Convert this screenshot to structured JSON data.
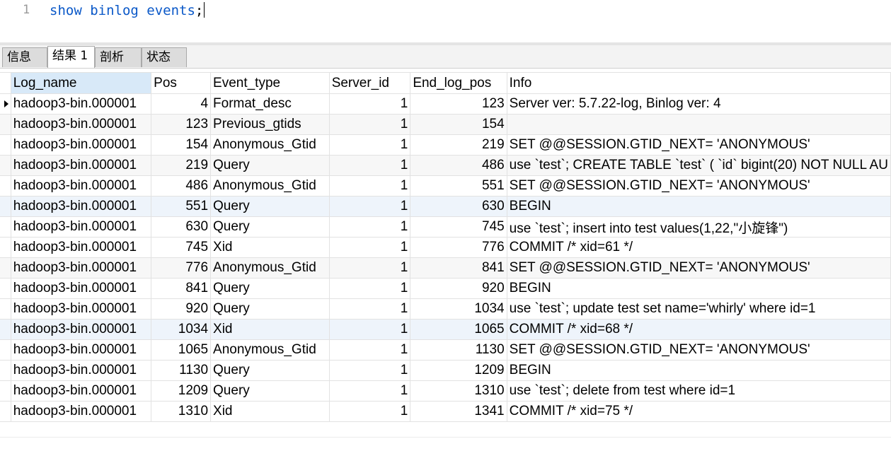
{
  "editor": {
    "line_number": "1",
    "query_text": "show binlog events",
    "terminator": ";"
  },
  "tabs": [
    {
      "label": "信息",
      "active": false
    },
    {
      "label": "结果 1",
      "active": true
    },
    {
      "label": "剖析",
      "active": false
    },
    {
      "label": "状态",
      "active": false
    }
  ],
  "grid": {
    "columns": [
      "Log_name",
      "Pos",
      "Event_type",
      "Server_id",
      "End_log_pos",
      "Info"
    ],
    "rows": [
      [
        "hadoop3-bin.000001",
        "4",
        "Format_desc",
        "1",
        "123",
        "Server ver: 5.7.22-log, Binlog ver: 4"
      ],
      [
        "hadoop3-bin.000001",
        "123",
        "Previous_gtids",
        "1",
        "154",
        ""
      ],
      [
        "hadoop3-bin.000001",
        "154",
        "Anonymous_Gtid",
        "1",
        "219",
        "SET @@SESSION.GTID_NEXT= 'ANONYMOUS'"
      ],
      [
        "hadoop3-bin.000001",
        "219",
        "Query",
        "1",
        "486",
        "use `test`; CREATE TABLE `test` (  `id` bigint(20) NOT NULL AU"
      ],
      [
        "hadoop3-bin.000001",
        "486",
        "Anonymous_Gtid",
        "1",
        "551",
        "SET @@SESSION.GTID_NEXT= 'ANONYMOUS'"
      ],
      [
        "hadoop3-bin.000001",
        "551",
        "Query",
        "1",
        "630",
        "BEGIN"
      ],
      [
        "hadoop3-bin.000001",
        "630",
        "Query",
        "1",
        "745",
        "use `test`; insert into test values(1,22,\"小旋锋\")"
      ],
      [
        "hadoop3-bin.000001",
        "745",
        "Xid",
        "1",
        "776",
        "COMMIT /* xid=61 */"
      ],
      [
        "hadoop3-bin.000001",
        "776",
        "Anonymous_Gtid",
        "1",
        "841",
        "SET @@SESSION.GTID_NEXT= 'ANONYMOUS'"
      ],
      [
        "hadoop3-bin.000001",
        "841",
        "Query",
        "1",
        "920",
        "BEGIN"
      ],
      [
        "hadoop3-bin.000001",
        "920",
        "Query",
        "1",
        "1034",
        "use `test`; update test set name='whirly' where id=1"
      ],
      [
        "hadoop3-bin.000001",
        "1034",
        "Xid",
        "1",
        "1065",
        "COMMIT /* xid=68 */"
      ],
      [
        "hadoop3-bin.000001",
        "1065",
        "Anonymous_Gtid",
        "1",
        "1130",
        "SET @@SESSION.GTID_NEXT= 'ANONYMOUS'"
      ],
      [
        "hadoop3-bin.000001",
        "1130",
        "Query",
        "1",
        "1209",
        "BEGIN"
      ],
      [
        "hadoop3-bin.000001",
        "1209",
        "Query",
        "1",
        "1310",
        "use `test`; delete from test where id=1"
      ],
      [
        "hadoop3-bin.000001",
        "1310",
        "Xid",
        "1",
        "1341",
        "COMMIT /* xid=75 */"
      ]
    ]
  }
}
